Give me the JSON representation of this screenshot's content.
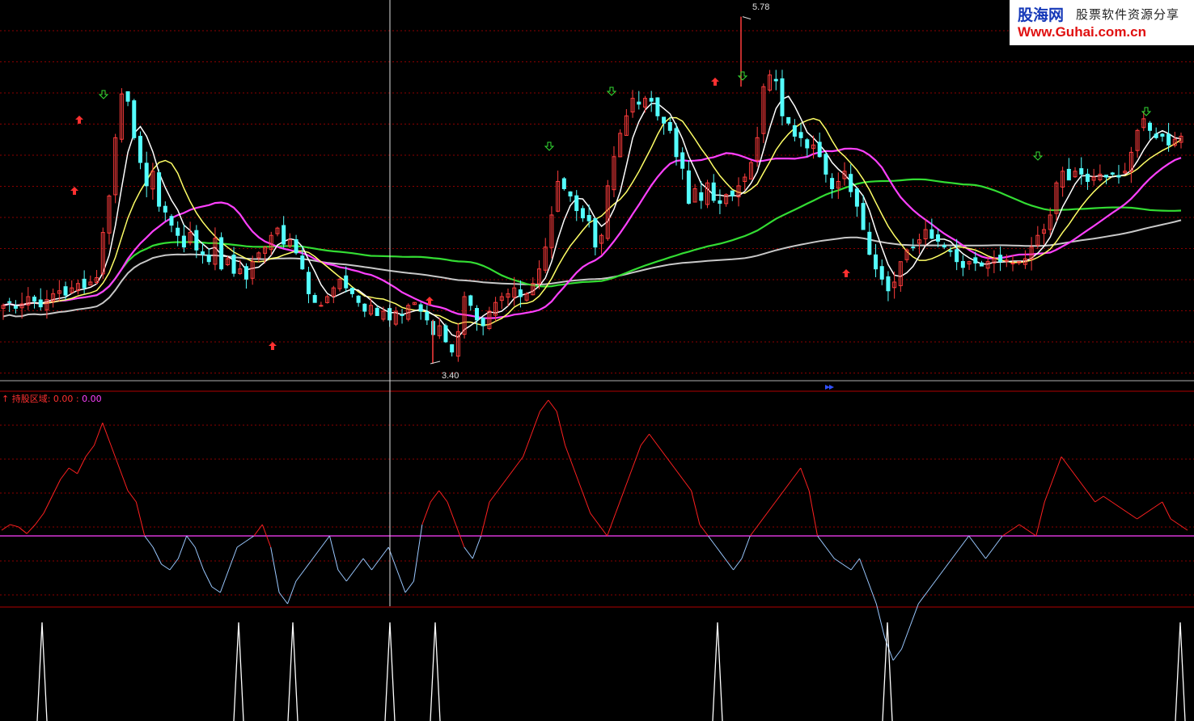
{
  "logo": {
    "name": "股海网",
    "subtitle": "股票软件资源分享",
    "url": "Www.Guhai.com.cn"
  },
  "price_high_label": "5.78",
  "price_low_label": "3.40",
  "indicator": {
    "name": "持股区域",
    "sep": ": ",
    "value1": "0.00",
    "sep2": " : ",
    "value2": "0.00"
  },
  "colors": {
    "background": "#000000",
    "grid": "#8b0000",
    "candle_up": "#ff3c3c",
    "candle_down": "#54ffff",
    "ma5": "#ffffff",
    "ma10": "#ffff66",
    "ma20": "#ff40ff",
    "ma60": "#33dd33",
    "ma120": "#c8c8c8",
    "ind_pos": "#ff2020",
    "ind_neg": "#9ac8ff",
    "ind_base": "#ff40ff",
    "spike": "#ffffff"
  },
  "chart_data": [
    {
      "type": "candlestick",
      "title": "",
      "ylim": [
        3.3,
        5.85
      ],
      "price_high": 5.78,
      "price_low": 3.4,
      "close": [
        3.8,
        3.82,
        3.78,
        3.81,
        3.86,
        3.83,
        3.79,
        3.84,
        3.88,
        3.9,
        3.87,
        3.92,
        3.95,
        3.92,
        3.96,
        3.99,
        4.3,
        4.55,
        4.95,
        5.25,
        5.2,
        4.95,
        4.78,
        4.62,
        4.72,
        4.48,
        4.44,
        4.35,
        4.28,
        4.2,
        4.3,
        4.18,
        4.15,
        4.1,
        4.26,
        4.05,
        4.12,
        4.02,
        4.05,
        3.98,
        4.1,
        4.16,
        4.2,
        4.28,
        4.33,
        4.22,
        4.25,
        4.16,
        4.05,
        3.88,
        3.82,
        3.8,
        3.86,
        3.92,
        3.98,
        3.92,
        3.88,
        3.82,
        3.76,
        3.8,
        3.73,
        3.76,
        3.7,
        3.76,
        3.73,
        3.8,
        3.82,
        3.76,
        3.7,
        3.6,
        3.66,
        3.55,
        3.48,
        3.62,
        3.86,
        3.8,
        3.7,
        3.66,
        3.76,
        3.82,
        3.86,
        3.88,
        3.92,
        3.86,
        3.88,
        3.95,
        4.05,
        4.2,
        4.42,
        4.65,
        4.6,
        4.55,
        4.45,
        4.4,
        4.38,
        4.2,
        4.28,
        4.62,
        4.82,
        4.98,
        5.1,
        5.22,
        5.18,
        5.22,
        5.2,
        5.1,
        5.05,
        5.0,
        4.82,
        4.74,
        4.5,
        4.6,
        4.52,
        4.64,
        4.52,
        4.5,
        4.56,
        4.55,
        4.62,
        4.68,
        4.78,
        4.95,
        5.3,
        5.38,
        5.34,
        5.1,
        5.05,
        4.96,
        4.95,
        4.88,
        4.9,
        4.82,
        4.7,
        4.6,
        4.65,
        4.72,
        4.58,
        4.48,
        4.32,
        4.15,
        4.05,
        3.98,
        3.9,
        3.96,
        4.1,
        4.18,
        4.2,
        4.25,
        4.32,
        4.26,
        4.24,
        4.2,
        4.17,
        4.1,
        4.06,
        4.1,
        4.09,
        4.07,
        4.1,
        4.12,
        4.1,
        4.11,
        4.09,
        4.1,
        4.12,
        4.2,
        4.28,
        4.32,
        4.42,
        4.64,
        4.72,
        4.66,
        4.72,
        4.7,
        4.65,
        4.68,
        4.7,
        4.68,
        4.7,
        4.68,
        4.72,
        4.85,
        5.0,
        5.08,
        5.0,
        4.95,
        4.96,
        4.9,
        4.94,
        4.96
      ]
    },
    {
      "type": "line",
      "title": "持股区域",
      "baseline": 0,
      "values": [
        0.05,
        0.1,
        0.08,
        0.02,
        0.1,
        0.2,
        0.35,
        0.5,
        0.6,
        0.55,
        0.7,
        0.8,
        1.0,
        0.8,
        0.6,
        0.4,
        0.3,
        0.0,
        -0.1,
        -0.25,
        -0.3,
        -0.2,
        0.0,
        -0.1,
        -0.3,
        -0.45,
        -0.5,
        -0.3,
        -0.1,
        -0.05,
        0.0,
        0.1,
        -0.1,
        -0.5,
        -0.6,
        -0.4,
        -0.3,
        -0.2,
        -0.1,
        0.0,
        -0.3,
        -0.4,
        -0.3,
        -0.2,
        -0.3,
        -0.2,
        -0.1,
        -0.3,
        -0.5,
        -0.4,
        0.1,
        0.3,
        0.4,
        0.3,
        0.1,
        -0.1,
        -0.2,
        0.0,
        0.3,
        0.4,
        0.5,
        0.6,
        0.7,
        0.9,
        1.1,
        1.2,
        1.1,
        0.8,
        0.6,
        0.4,
        0.2,
        0.1,
        0.0,
        0.2,
        0.4,
        0.6,
        0.8,
        0.9,
        0.8,
        0.7,
        0.6,
        0.5,
        0.4,
        0.1,
        0.0,
        -0.1,
        -0.2,
        -0.3,
        -0.2,
        0.0,
        0.1,
        0.2,
        0.3,
        0.4,
        0.5,
        0.6,
        0.4,
        0.0,
        -0.1,
        -0.2,
        -0.25,
        -0.3,
        -0.2,
        -0.4,
        -0.6,
        -0.9,
        -1.1,
        -1.0,
        -0.8,
        -0.6,
        -0.5,
        -0.4,
        -0.3,
        -0.2,
        -0.1,
        0.0,
        -0.1,
        -0.2,
        -0.1,
        0.0,
        0.05,
        0.1,
        0.05,
        0.0,
        0.3,
        0.5,
        0.7,
        0.6,
        0.5,
        0.4,
        0.3,
        0.35,
        0.3,
        0.25,
        0.2,
        0.15,
        0.2,
        0.25,
        0.3,
        0.15,
        0.1,
        0.05
      ]
    },
    {
      "type": "spikes",
      "title": "",
      "positions": [
        52,
        295,
        362,
        482,
        538,
        887,
        1097,
        1459
      ]
    }
  ]
}
